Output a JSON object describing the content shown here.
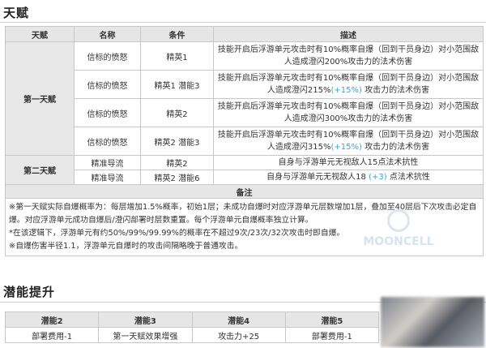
{
  "talent_section": {
    "title": "天赋"
  },
  "talent_table": {
    "headers": [
      "天赋",
      "名称",
      "条件",
      "描述"
    ],
    "groups": [
      {
        "name": "第一天赋",
        "rows": [
          {
            "skill": "信标的愤怒",
            "condition": "精英1",
            "desc_pre": "技能开启后浮游单元攻击时有10%概率自爆（回到干员身边）对小范围敌人造成澄闪200%攻击力的法术伤害",
            "desc_hl": "",
            "desc_post": ""
          },
          {
            "skill": "信标的愤怒",
            "condition": "精英1 潜能3",
            "desc_pre": "技能开启后浮游单元攻击时有10%概率自爆（回到干员身边）对小范围敌人造成澄闪215%",
            "desc_hl": "(+15%)",
            "desc_post": "攻击力的法术伤害"
          },
          {
            "skill": "信标的愤怒",
            "condition": "精英2",
            "desc_pre": "技能开启后浮游单元攻击时有10%概率自爆（回到干员身边）对小范围敌人造成澄闪300%攻击力的法术伤害",
            "desc_hl": "",
            "desc_post": ""
          },
          {
            "skill": "信标的愤怒",
            "condition": "精英2 潜能3",
            "desc_pre": "技能开启后浮游单元攻击时有10%概率自爆（回到干员身边）对小范围敌人造成澄闪315%",
            "desc_hl": "(+15%)",
            "desc_post": "攻击力的法术伤害"
          }
        ]
      },
      {
        "name": "第二天赋",
        "rows": [
          {
            "skill": "精准导流",
            "condition": "精英2",
            "desc_pre": "自身与浮游单元无视敌人15点法术抗性",
            "desc_hl": "",
            "desc_post": ""
          },
          {
            "skill": "精准导流",
            "condition": "精英2 潜能6",
            "desc_pre": "自身与浮游单元无视敌人18",
            "desc_hl": "(+3)",
            "desc_post": "点法术抗性"
          }
        ]
      }
    ],
    "note_header": "备注",
    "notes": [
      "※第一天赋实际自爆概率为：每层增加1.5%概率，初始1层；未成功自爆时对应浮游单元层数增加1层，叠加至40层后下次攻击必定自爆。对应浮游单元成功自爆后/澄闪部署时层数重置。每个浮游单元自爆概率独立计算。",
      "*在该逻辑下，浮游单元有约50%/99%/99.99%的概率在不超过9次/23次/32次攻击时即自爆。",
      "※自爆伤害半径1.1，浮游单元自爆时的攻击间隔略晚于普通攻击。"
    ]
  },
  "watermark": {
    "text": "MOONCELL"
  },
  "potential_section": {
    "title": "潜能提升"
  },
  "potential_table": {
    "headers": [
      "潜能2",
      "潜能3",
      "潜能4",
      "潜能5"
    ],
    "values": [
      "部署费用-1",
      "第一天赋效果增强",
      "攻击力+25",
      "部署费用-1"
    ]
  }
}
